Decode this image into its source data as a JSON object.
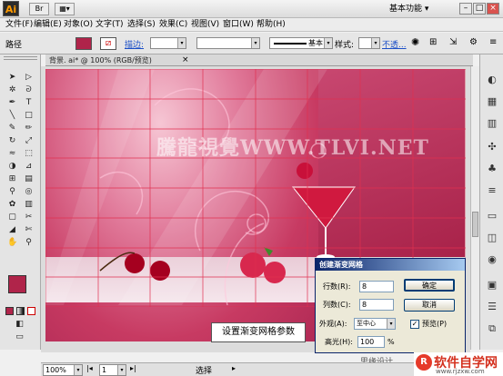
{
  "title_bar": {
    "app_logo": "Ai",
    "br_icon": "Br",
    "workspace": "基本功能",
    "icons": [
      "minimize-icon",
      "maximize-icon",
      "close-icon"
    ]
  },
  "menus": [
    "文件(F)",
    "编辑(E)",
    "对象(O)",
    "文字(T)",
    "选择(S)",
    "效果(C)",
    "视图(V)",
    "窗口(W)",
    "帮助(H)"
  ],
  "control_bar": {
    "object_label": "路径",
    "fill_color": "#b0244a",
    "stroke_label": "描边:",
    "stroke_style": "基本",
    "style_label": "样式:",
    "opacity_label": "不透..."
  },
  "document": {
    "tab_title": "背景. ai* @ 100% (RGB/预览)",
    "watermark": "騰龍視覺WWW.TLVI.NET",
    "callout": "设置渐变网格参数",
    "footer_text": "思缘设计"
  },
  "dialog": {
    "title": "创建渐变网格",
    "rows_label": "行数(R):",
    "rows_value": "8",
    "cols_label": "列数(C):",
    "cols_value": "8",
    "appearance_label": "外观(A):",
    "appearance_value": "至中心",
    "highlight_label": "高光(H):",
    "highlight_value": "100",
    "highlight_unit": "%",
    "ok": "确定",
    "cancel": "取消",
    "preview": "预览(P)",
    "preview_checked": true
  },
  "status_bar": {
    "zoom": "100%",
    "page": "1",
    "status": "选择"
  },
  "brand_logo": "软件自学网",
  "brand_url": "www.rjzxw.com",
  "accent": "#b0244a"
}
